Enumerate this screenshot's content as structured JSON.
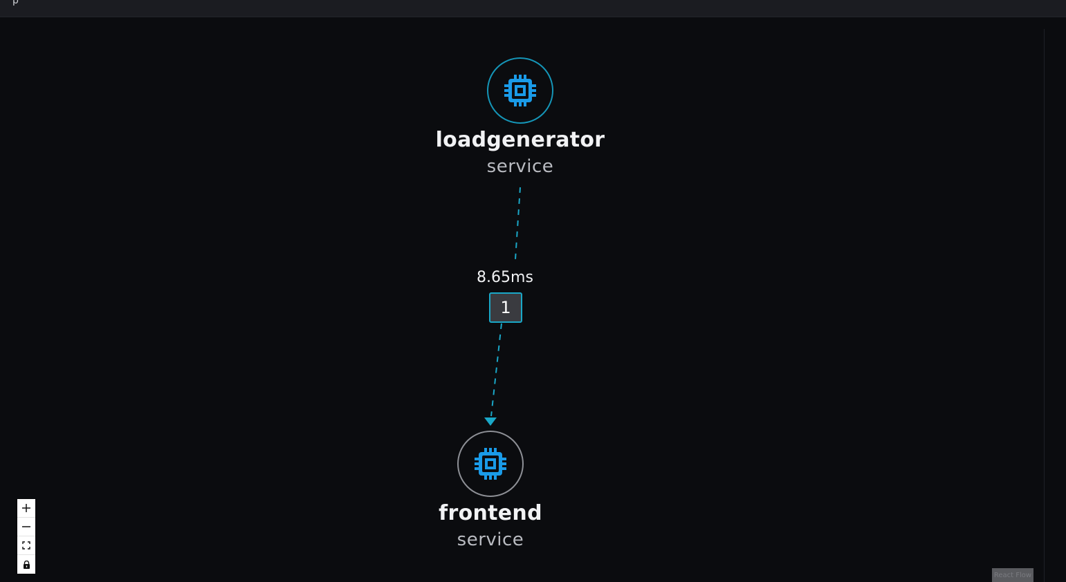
{
  "header": {
    "title_fragment": "p"
  },
  "graph": {
    "nodes": [
      {
        "id": "loadgenerator",
        "title": "loadgenerator",
        "subtitle": "service",
        "icon": "cpu-icon"
      },
      {
        "id": "frontend",
        "title": "frontend",
        "subtitle": "service",
        "icon": "cpu-icon"
      }
    ],
    "edge": {
      "latency": "8.65ms",
      "count": "1"
    }
  },
  "controls": {
    "zoom_in": "+",
    "zoom_out": "−",
    "fit_view": "⛶",
    "lock": "🔒"
  },
  "attribution": "React Flow",
  "colors": {
    "accent": "#1596b8",
    "edge": "#1aa8c8",
    "icon": "#1a9be8",
    "background": "#0b0c0f"
  }
}
